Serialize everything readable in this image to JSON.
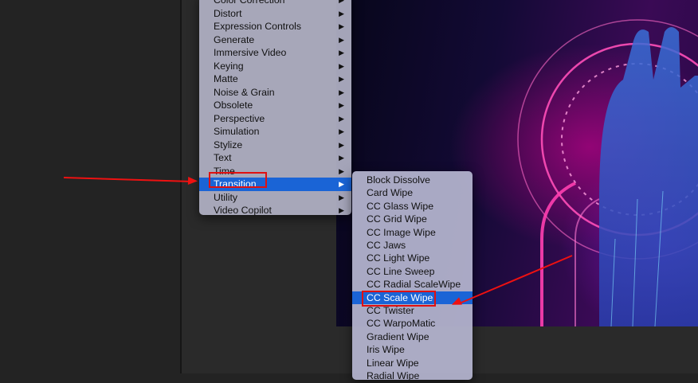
{
  "effects_menu": {
    "items": [
      {
        "label": "Color Correction",
        "has_submenu": true
      },
      {
        "label": "Distort",
        "has_submenu": true
      },
      {
        "label": "Expression Controls",
        "has_submenu": true
      },
      {
        "label": "Generate",
        "has_submenu": true
      },
      {
        "label": "Immersive Video",
        "has_submenu": true
      },
      {
        "label": "Keying",
        "has_submenu": true
      },
      {
        "label": "Matte",
        "has_submenu": true
      },
      {
        "label": "Noise & Grain",
        "has_submenu": true
      },
      {
        "label": "Obsolete",
        "has_submenu": true
      },
      {
        "label": "Perspective",
        "has_submenu": true
      },
      {
        "label": "Simulation",
        "has_submenu": true
      },
      {
        "label": "Stylize",
        "has_submenu": true
      },
      {
        "label": "Text",
        "has_submenu": true
      },
      {
        "label": "Time",
        "has_submenu": true
      },
      {
        "label": "Transition",
        "has_submenu": true,
        "selected": true
      },
      {
        "label": "Utility",
        "has_submenu": true
      },
      {
        "label": "Video Copilot",
        "has_submenu": true
      }
    ],
    "arrow_glyph": "▶"
  },
  "transition_submenu": {
    "items": [
      {
        "label": "Block Dissolve"
      },
      {
        "label": "Card Wipe"
      },
      {
        "label": "CC Glass Wipe"
      },
      {
        "label": "CC Grid Wipe"
      },
      {
        "label": "CC Image Wipe"
      },
      {
        "label": "CC Jaws"
      },
      {
        "label": "CC Light Wipe"
      },
      {
        "label": "CC Line Sweep"
      },
      {
        "label": "CC Radial ScaleWipe"
      },
      {
        "label": "CC Scale Wipe",
        "selected": true
      },
      {
        "label": "CC Twister"
      },
      {
        "label": "CC WarpoMatic"
      },
      {
        "label": "Gradient Wipe"
      },
      {
        "label": "Iris Wipe"
      },
      {
        "label": "Linear Wipe"
      },
      {
        "label": "Radial Wipe"
      }
    ]
  },
  "colors": {
    "selection_blue": "#1a64d6",
    "annotation_red": "#e01010"
  }
}
